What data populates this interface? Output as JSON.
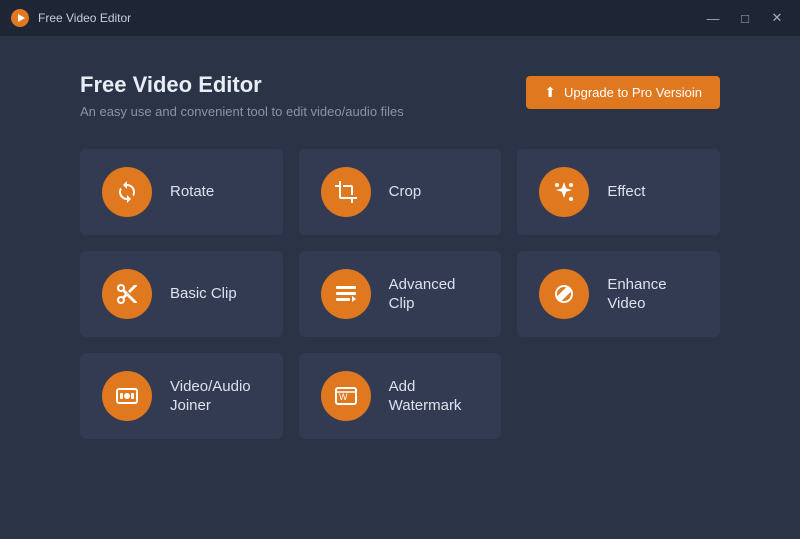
{
  "app": {
    "name": "Free Video Editor",
    "logo_label": "app-logo"
  },
  "title_bar": {
    "title": "Free Video Editor",
    "btn_minimize": "—",
    "btn_maximize": "□",
    "btn_close": "✕"
  },
  "header": {
    "page_title": "Free Video Editor",
    "page_subtitle": "An easy use and convenient tool to edit video/audio files",
    "upgrade_btn": "Upgrade to Pro Versioin",
    "upgrade_icon": "⬆"
  },
  "tools": [
    {
      "id": "rotate",
      "label": "Rotate",
      "icon": "rotate"
    },
    {
      "id": "crop",
      "label": "Crop",
      "icon": "crop"
    },
    {
      "id": "effect",
      "label": "Effect",
      "icon": "effect"
    },
    {
      "id": "basic-clip",
      "label": "Basic Clip",
      "icon": "scissors"
    },
    {
      "id": "advanced-clip",
      "label": "Advanced Clip",
      "icon": "advanced-clip"
    },
    {
      "id": "enhance-video",
      "label": "Enhance\nVideo",
      "icon": "enhance"
    },
    {
      "id": "video-audio-joiner",
      "label": "Video/Audio\nJoiner",
      "icon": "joiner"
    },
    {
      "id": "add-watermark",
      "label": "Add\nWatermark",
      "icon": "watermark"
    }
  ],
  "colors": {
    "accent": "#e07820",
    "bg_main": "#2b3346",
    "bg_card": "#323b52",
    "bg_titlebar": "#1e2534"
  }
}
